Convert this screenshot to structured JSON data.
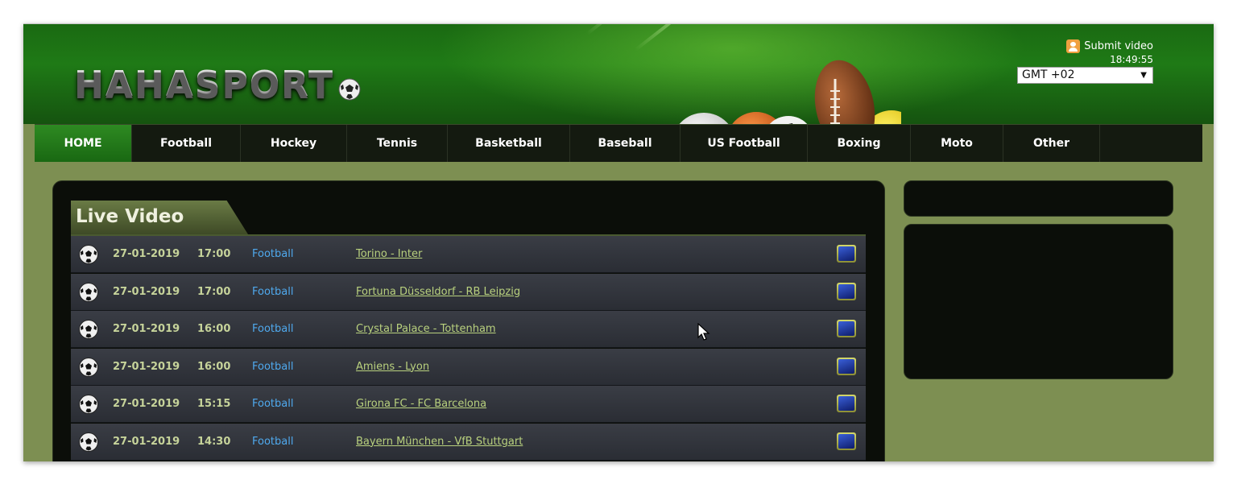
{
  "site": {
    "logo_text": "HAHASPORT",
    "submit_video": "Submit video",
    "clock": "18:49:55",
    "timezone": "GMT +02"
  },
  "nav": {
    "items": [
      "HOME",
      "Football",
      "Hockey",
      "Tennis",
      "Basketball",
      "Baseball",
      "US Football",
      "Boxing",
      "Moto",
      "Other"
    ],
    "active": "HOME"
  },
  "live_video": {
    "title": "Live Video",
    "rows": [
      {
        "date": "27-01-2019",
        "time": "17:00",
        "sport": "Football",
        "match": "Torino - Inter"
      },
      {
        "date": "27-01-2019",
        "time": "17:00",
        "sport": "Football",
        "match": "Fortuna Düsseldorf - RB Leipzig"
      },
      {
        "date": "27-01-2019",
        "time": "16:00",
        "sport": "Football",
        "match": "Crystal Palace - Tottenham"
      },
      {
        "date": "27-01-2019",
        "time": "16:00",
        "sport": "Football",
        "match": "Amiens - Lyon"
      },
      {
        "date": "27-01-2019",
        "time": "15:15",
        "sport": "Football",
        "match": "Girona FC - FC Barcelona"
      },
      {
        "date": "27-01-2019",
        "time": "14:30",
        "sport": "Football",
        "match": "Bayern München - VfB Stuttgart"
      }
    ]
  },
  "colors": {
    "header_green": "#1f7a16",
    "nav_bg": "#141a10",
    "body_olive": "#7d8f52",
    "date_text": "#c6d39a",
    "sport_link": "#4fa9ee",
    "match_link": "#b9d17e"
  },
  "icons": {
    "logo_ball": "soccer-ball-icon",
    "row_icon": "soccer-ball-icon",
    "row_action": "tv-icon",
    "submit_icon": "user-icon"
  }
}
